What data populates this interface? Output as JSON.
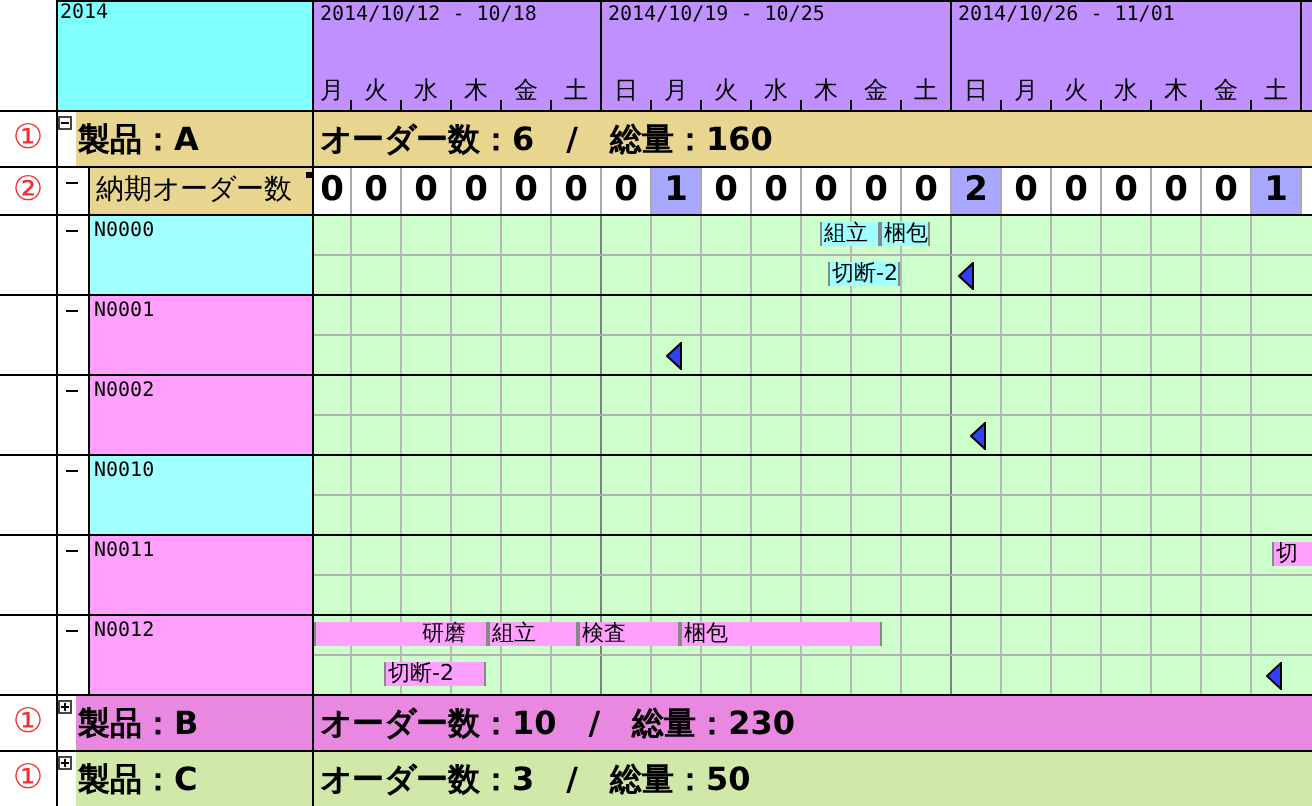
{
  "year": "2014",
  "weeks": [
    {
      "label": "2014/10/12 - 10/18",
      "days": [
        "月",
        "火",
        "水",
        "木",
        "金",
        "土"
      ]
    },
    {
      "label": "2014/10/19 - 10/25",
      "days": [
        "日",
        "月",
        "火",
        "水",
        "木",
        "金",
        "土"
      ]
    },
    {
      "label": "2014/10/26 - 11/01",
      "days": [
        "日",
        "月",
        "火",
        "水",
        "木",
        "金",
        "土"
      ]
    }
  ],
  "products": [
    {
      "annotation": "①",
      "name": "製品：A",
      "summary": "オーダー数：6　/　総量：160",
      "color": "#e8d590",
      "expanded": true,
      "due_counts": {
        "annotation": "②",
        "label": "納期オーダー数",
        "cells": [
          {
            "value": "0",
            "highlighted": false
          },
          {
            "value": "0",
            "highlighted": false
          },
          {
            "value": "0",
            "highlighted": false
          },
          {
            "value": "0",
            "highlighted": false
          },
          {
            "value": "0",
            "highlighted": false
          },
          {
            "value": "0",
            "highlighted": false
          },
          {
            "value": "0",
            "highlighted": false
          },
          {
            "value": "1",
            "highlighted": true
          },
          {
            "value": "0",
            "highlighted": false
          },
          {
            "value": "0",
            "highlighted": false
          },
          {
            "value": "0",
            "highlighted": false
          },
          {
            "value": "0",
            "highlighted": false
          },
          {
            "value": "0",
            "highlighted": false
          },
          {
            "value": "2",
            "highlighted": true
          },
          {
            "value": "0",
            "highlighted": false
          },
          {
            "value": "0",
            "highlighted": false
          },
          {
            "value": "0",
            "highlighted": false
          },
          {
            "value": "0",
            "highlighted": false
          },
          {
            "value": "0",
            "highlighted": false
          },
          {
            "value": "1",
            "highlighted": true
          }
        ]
      },
      "orders": [
        {
          "id": "N0000",
          "color": "#a0ffff",
          "line_1": [
            {
              "kind": "bar",
              "label": "組立"
            },
            {
              "kind": "bar",
              "label": "梱包"
            }
          ],
          "line_2": [
            {
              "kind": "bar",
              "label": "切断-2"
            },
            {
              "kind": "marker"
            }
          ]
        },
        {
          "id": "N0001",
          "color": "#ffa0ff",
          "line_2": [
            {
              "kind": "marker"
            }
          ]
        },
        {
          "id": "N0002",
          "color": "#ffa0ff",
          "line_2": [
            {
              "kind": "marker"
            }
          ]
        },
        {
          "id": "N0010",
          "color": "#a0ffff"
        },
        {
          "id": "N0011",
          "color": "#ffa0ff",
          "line_1": [
            {
              "kind": "bar",
              "label": "切"
            }
          ]
        },
        {
          "id": "N0012",
          "color": "#ffa0ff",
          "line_1": [
            {
              "kind": "bar",
              "label": "研磨"
            },
            {
              "kind": "bar",
              "label": "組立"
            },
            {
              "kind": "bar",
              "label": "検査"
            },
            {
              "kind": "bar",
              "label": "梱包"
            }
          ],
          "line_2": [
            {
              "kind": "bar",
              "label": "切断-2"
            },
            {
              "kind": "marker"
            }
          ]
        }
      ]
    },
    {
      "annotation": "①",
      "name": "製品：B",
      "summary": "オーダー数：10　/　総量：230",
      "color": "#e888e0",
      "expanded": false
    },
    {
      "annotation": "①",
      "name": "製品：C",
      "summary": "オーダー数：3　/　総量：50",
      "color": "#d0e8a8",
      "expanded": false
    }
  ]
}
